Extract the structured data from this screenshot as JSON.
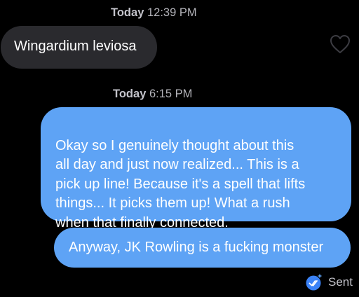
{
  "conversation": {
    "timestamps": [
      {
        "day": "Today",
        "time": "12:39 PM"
      },
      {
        "day": "Today",
        "time": "6:15 PM"
      }
    ],
    "messages": [
      {
        "direction": "incoming",
        "text": "Wingardium leviosa"
      },
      {
        "direction": "outgoing",
        "text": "Okay so I genuinely thought about this\nall day and just now realized... This is a\npick up line! Because it's a spell that lifts\nthings... It picks them up! What a rush\nwhen that finally connected."
      },
      {
        "direction": "outgoing",
        "text": "Anyway, JK Rowling is a fucking monster"
      }
    ],
    "like_icon": "heart-outline-icon",
    "receipt": {
      "icon": "double-check-icon",
      "label": "Sent"
    }
  },
  "colors": {
    "background": "#000000",
    "incoming_bubble": "#2a2a2e",
    "outgoing_bubble": "#5ea3f5",
    "timestamp_text": "#b3b3b9",
    "receipt_badge": "#3b82f6"
  }
}
